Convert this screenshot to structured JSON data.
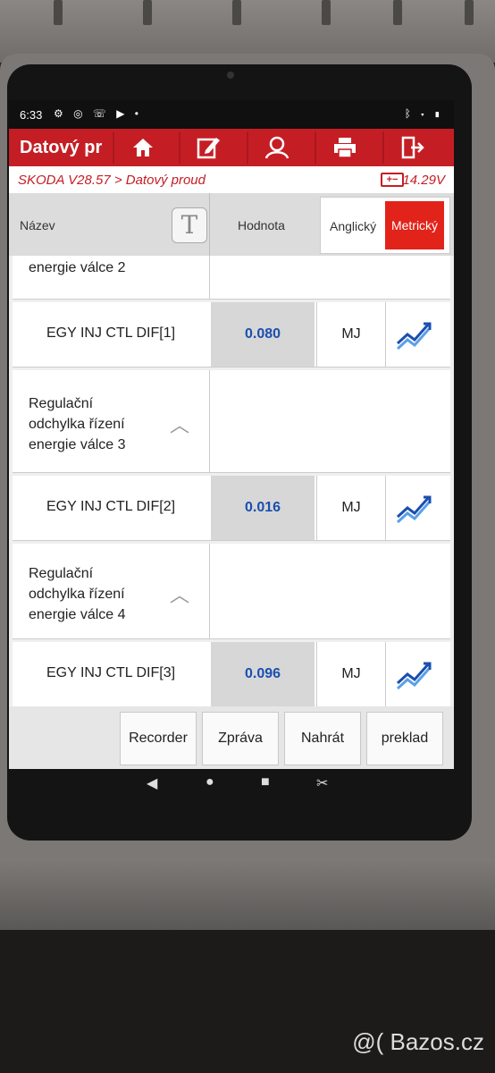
{
  "status_bar": {
    "time": "6:33",
    "left_icons": [
      "gear-icon",
      "voicemail-icon",
      "phone-icon",
      "youtube-icon",
      "dot-icon"
    ],
    "right_icons": [
      "bluetooth-icon",
      "wifi-icon",
      "battery-icon"
    ]
  },
  "app": {
    "title": "Datový proud",
    "toolbar_icons": [
      "home-icon",
      "edit-icon",
      "user-icon",
      "printer-icon",
      "exit-icon"
    ],
    "accent": "#c41e24"
  },
  "subheader": {
    "path": "SKODA V28.57 > Datový proud",
    "voltage": "14.29V"
  },
  "columns": {
    "name": "Název",
    "value": "Hodnota",
    "units_english": "Anglický",
    "units_metric": "Metrický",
    "selected_units": "Metrický"
  },
  "list": {
    "partial_group": "energie válce 2",
    "groups": [
      {
        "name_lines": [
          "Regulační",
          "odchylka řízení",
          "energie válce 3"
        ]
      },
      {
        "name_lines": [
          "Regulační",
          "odchylka řízení",
          "energie válce 4"
        ]
      }
    ],
    "rows": [
      {
        "name": "EGY INJ CTL DIF[1]",
        "value": "0.080",
        "unit": "MJ"
      },
      {
        "name": "EGY INJ CTL DIF[2]",
        "value": "0.016",
        "unit": "MJ"
      },
      {
        "name": "EGY INJ CTL DIF[3]",
        "value": "0.096",
        "unit": "MJ"
      }
    ]
  },
  "buttons": {
    "record": "Recorder",
    "report": "Zpráva",
    "upload": "Nahrát",
    "translate": "preklad"
  },
  "watermark": "@( Bazos.cz"
}
